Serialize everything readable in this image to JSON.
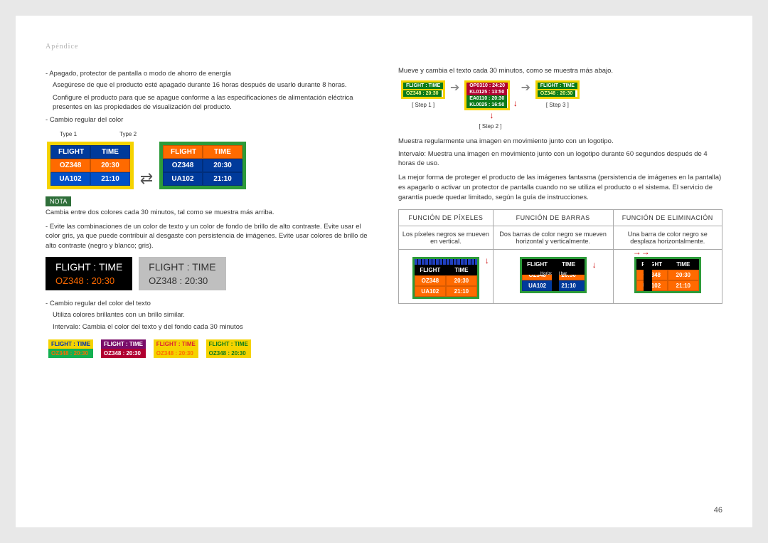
{
  "section": "Apéndice",
  "page": "46",
  "left": {
    "b1": "Apagado, protector de pantalla o modo de ahorro de energía",
    "b1_s1": "Asegúrese de que el producto esté apagado durante 16 horas después de usarlo durante 8 horas.",
    "b1_s2": "Configure el producto para que se apague conforme a las especificaciones de alimentación eléctrica presentes en las propiedades de visualización del producto.",
    "b2": "Cambio regular del color",
    "type1": "Type 1",
    "type2": "Type 2",
    "flight": "FLIGHT",
    "time": "TIME",
    "oz": "OZ348",
    "oz_t": "20:30",
    "ua": "UA102",
    "ua_t": "21:10",
    "nota": "NOTA",
    "nota_txt": "Cambia entre dos colores cada 30 minutos, tal como se muestra más arriba.",
    "b3": "Evite las combinaciones de un color de texto y un color de fondo de brillo de alto contraste. Evite usar el color gris, ya que puede contribuir al desgaste con persistencia de imágenes. Evite usar colores de brillo de alto contraste (negro y blanco; gris).",
    "big1": "FLIGHT   :   TIME",
    "big2": "OZ348    :    20:30",
    "b4": "Cambio regular del color del texto",
    "b4_s1": "Utiliza colores brillantes con un brillo similar.",
    "b4_s2": "Intervalo: Cambia el color del texto y del fondo cada 30 minutos",
    "sm_top": "FLIGHT  :  TIME",
    "sm_bot": "OZ348  :  20:30"
  },
  "right": {
    "p1": "Mueve y cambia el texto cada 30 minutos, como se muestra más abajo.",
    "step1": "[ Step 1 ]",
    "step2": "[ Step 2 ]",
    "step3": "[ Step 3 ]",
    "s2r1": "OP0310  :  24:20",
    "s2r2": "KL0125  :  13:50",
    "s2r3": "EA0110  :  20:30",
    "s2r4": "KL0025  :  16:50",
    "p2": "Muestra regularmente una imagen en movimiento junto con un logotipo.",
    "p2s": "Intervalo: Muestra una imagen en movimiento junto con un logotipo durante 60 segundos después de 4 horas de uso.",
    "p3": "La mejor forma de proteger el producto de las imágenes fantasma (persistencia de imágenes en la pantalla) es apagarlo o activar un protector de pantalla cuando no se utiliza el producto o el sistema. El servicio de garantía puede quedar limitado, según la guía de instrucciones.",
    "th1": "FUNCIÓN DE PÍXELES",
    "th2": "FUNCIÓN DE BARRAS",
    "th3": "FUNCIÓN DE ELIMINACIÓN",
    "td1": "Los píxeles negros se mueven en vertical.",
    "td2": "Dos barras de color negro se mueven horizontal y verticalmente.",
    "td3": "Una barra de color negro se desplaza horizontalmente.",
    "hbar_label": "Horizontal bar"
  }
}
